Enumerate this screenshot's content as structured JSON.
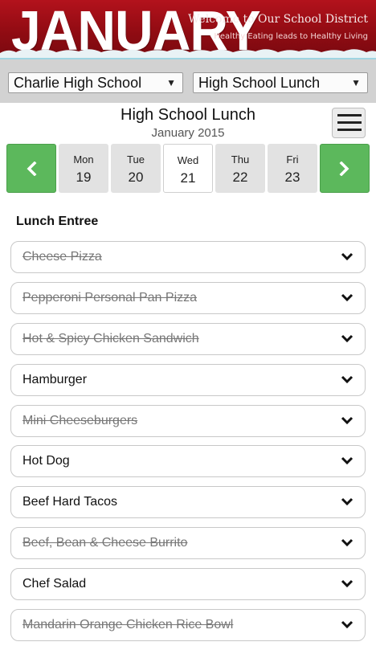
{
  "banner": {
    "month": "JANUARY",
    "welcome": "Welcome to Our School District",
    "tagline": "Healthy Eating leads to Healthy Living"
  },
  "selectors": {
    "school": "Charlie High School",
    "menu": "High School Lunch"
  },
  "header": {
    "title": "High School Lunch",
    "subtitle": "January 2015"
  },
  "date_nav": {
    "days": [
      {
        "name": "Mon",
        "num": "19"
      },
      {
        "name": "Tue",
        "num": "20"
      },
      {
        "name": "Wed",
        "num": "21",
        "active": true
      },
      {
        "name": "Thu",
        "num": "22"
      },
      {
        "name": "Fri",
        "num": "23"
      }
    ]
  },
  "section": {
    "heading": "Lunch Entree",
    "items": [
      {
        "label": "Cheese Pizza",
        "available": false
      },
      {
        "label": "Pepperoni Personal Pan Pizza",
        "available": false
      },
      {
        "label": "Hot & Spicy Chicken Sandwich",
        "available": false
      },
      {
        "label": "Hamburger",
        "available": true
      },
      {
        "label": "Mini Cheeseburgers",
        "available": false
      },
      {
        "label": "Hot Dog",
        "available": true
      },
      {
        "label": "Beef Hard Tacos",
        "available": true
      },
      {
        "label": "Beef, Bean & Cheese Burrito",
        "available": false
      },
      {
        "label": "Chef Salad",
        "available": true
      },
      {
        "label": "Mandarin Orange Chicken Rice Bowl",
        "available": false
      }
    ]
  },
  "colors": {
    "banner_red": "#b3121c",
    "nav_green": "#5cb85c",
    "selector_bar": "#d2d2d2"
  },
  "icons": {
    "prev": "chevron-left-icon",
    "next": "chevron-right-icon",
    "menu": "hamburger-icon",
    "expand": "chevron-down-icon"
  }
}
